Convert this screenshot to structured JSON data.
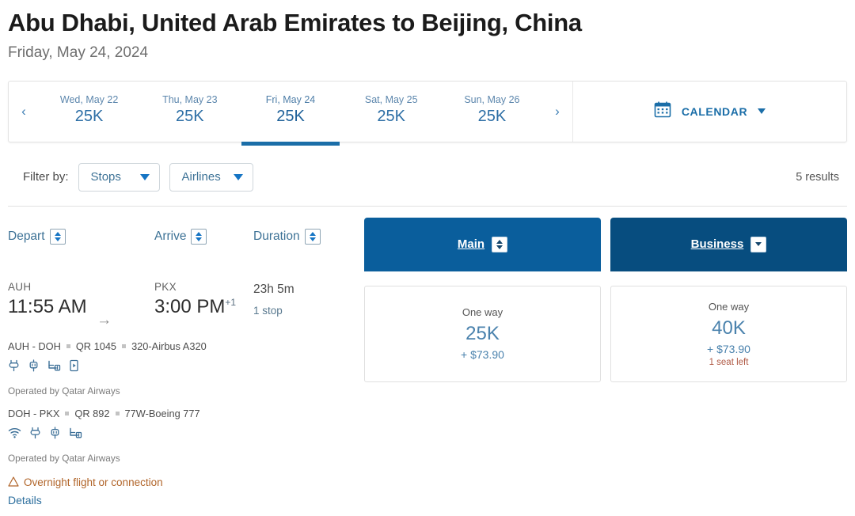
{
  "header": {
    "title": "Abu Dhabi, United Arab Emirates to Beijing, China",
    "subtitle": "Friday, May 24, 2024"
  },
  "date_strip": {
    "prev_icon": "‹",
    "next_icon": "›",
    "days": [
      {
        "label": "Wed, May 22",
        "price": "25K",
        "active": false
      },
      {
        "label": "Thu, May 23",
        "price": "25K",
        "active": false
      },
      {
        "label": "Fri, May 24",
        "price": "25K",
        "active": true
      },
      {
        "label": "Sat, May 25",
        "price": "25K",
        "active": false
      },
      {
        "label": "Sun, May 26",
        "price": "25K",
        "active": false
      }
    ],
    "calendar_label": "CALENDAR",
    "calendar_icon": "calendar-icon"
  },
  "filters": {
    "label": "Filter by:",
    "buttons": [
      {
        "label": "Stops"
      },
      {
        "label": "Airlines"
      }
    ],
    "results_count": "5 results"
  },
  "columns": {
    "depart": "Depart",
    "arrive": "Arrive",
    "duration": "Duration"
  },
  "fare_tabs": [
    {
      "label": "Main",
      "color": "#0a5e9c",
      "sort": "both"
    },
    {
      "label": "Business",
      "color": "#074d7f",
      "sort": "down"
    }
  ],
  "flight": {
    "depart_code": "AUH",
    "depart_time": "11:55 AM",
    "arrow_icon": "arrow-right-icon",
    "arrive_code": "PKX",
    "arrive_time": "3:00 PM",
    "arrive_day_offset": "+1",
    "duration": "23h 5m",
    "stops": "1 stop",
    "segments": [
      {
        "route": "AUH - DOH",
        "flight_number": "QR 1045",
        "aircraft": "320-Airbus A320",
        "amenities": [
          "power-outlet-icon",
          "usb-power-icon",
          "seat-power-icon",
          "entertainment-screen-icon"
        ],
        "operated_by": "Operated by Qatar Airways"
      },
      {
        "route": "DOH - PKX",
        "flight_number": "QR 892",
        "aircraft": "77W-Boeing 777",
        "amenities": [
          "wifi-icon",
          "power-outlet-icon",
          "usb-power-icon",
          "seat-power-icon"
        ],
        "operated_by": "Operated by Qatar Airways"
      }
    ],
    "warning": "Overnight flight or connection",
    "warning_icon": "warning-triangle-icon",
    "details_link": "Details"
  },
  "fare_cards": [
    {
      "one_way": "One way",
      "miles": "25K",
      "cash": "+ $73.90",
      "seats_left": ""
    },
    {
      "one_way": "One way",
      "miles": "40K",
      "cash": "+ $73.90",
      "seats_left": "1 seat left"
    }
  ]
}
